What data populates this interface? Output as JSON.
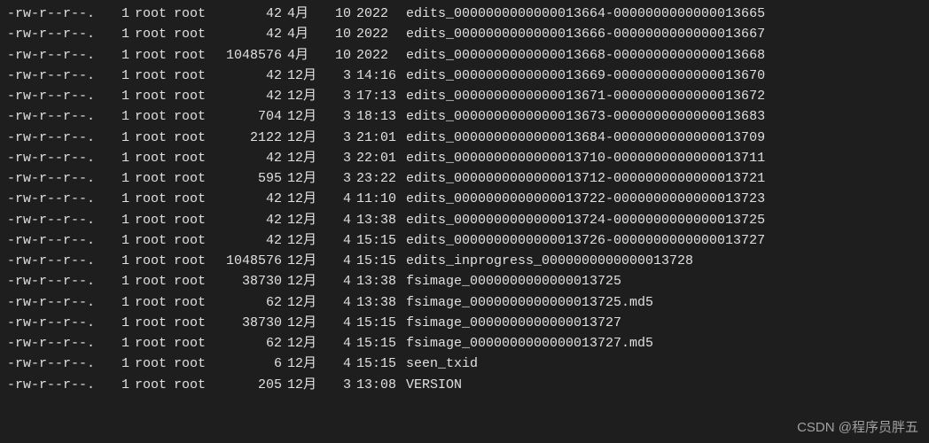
{
  "files": [
    {
      "perms": "-rw-r--r--.",
      "links": "1",
      "owner": "root",
      "group": "root",
      "size": "42",
      "month": "4月",
      "day": "10",
      "time": "2022",
      "name": "edits_0000000000000013664-0000000000000013665"
    },
    {
      "perms": "-rw-r--r--.",
      "links": "1",
      "owner": "root",
      "group": "root",
      "size": "42",
      "month": "4月",
      "day": "10",
      "time": "2022",
      "name": "edits_0000000000000013666-0000000000000013667"
    },
    {
      "perms": "-rw-r--r--.",
      "links": "1",
      "owner": "root",
      "group": "root",
      "size": "1048576",
      "month": "4月",
      "day": "10",
      "time": "2022",
      "name": "edits_0000000000000013668-0000000000000013668"
    },
    {
      "perms": "-rw-r--r--.",
      "links": "1",
      "owner": "root",
      "group": "root",
      "size": "42",
      "month": "12月",
      "day": "3",
      "time": "14:16",
      "name": "edits_0000000000000013669-0000000000000013670"
    },
    {
      "perms": "-rw-r--r--.",
      "links": "1",
      "owner": "root",
      "group": "root",
      "size": "42",
      "month": "12月",
      "day": "3",
      "time": "17:13",
      "name": "edits_0000000000000013671-0000000000000013672"
    },
    {
      "perms": "-rw-r--r--.",
      "links": "1",
      "owner": "root",
      "group": "root",
      "size": "704",
      "month": "12月",
      "day": "3",
      "time": "18:13",
      "name": "edits_0000000000000013673-0000000000000013683"
    },
    {
      "perms": "-rw-r--r--.",
      "links": "1",
      "owner": "root",
      "group": "root",
      "size": "2122",
      "month": "12月",
      "day": "3",
      "time": "21:01",
      "name": "edits_0000000000000013684-0000000000000013709"
    },
    {
      "perms": "-rw-r--r--.",
      "links": "1",
      "owner": "root",
      "group": "root",
      "size": "42",
      "month": "12月",
      "day": "3",
      "time": "22:01",
      "name": "edits_0000000000000013710-0000000000000013711"
    },
    {
      "perms": "-rw-r--r--.",
      "links": "1",
      "owner": "root",
      "group": "root",
      "size": "595",
      "month": "12月",
      "day": "3",
      "time": "23:22",
      "name": "edits_0000000000000013712-0000000000000013721"
    },
    {
      "perms": "-rw-r--r--.",
      "links": "1",
      "owner": "root",
      "group": "root",
      "size": "42",
      "month": "12月",
      "day": "4",
      "time": "11:10",
      "name": "edits_0000000000000013722-0000000000000013723"
    },
    {
      "perms": "-rw-r--r--.",
      "links": "1",
      "owner": "root",
      "group": "root",
      "size": "42",
      "month": "12月",
      "day": "4",
      "time": "13:38",
      "name": "edits_0000000000000013724-0000000000000013725"
    },
    {
      "perms": "-rw-r--r--.",
      "links": "1",
      "owner": "root",
      "group": "root",
      "size": "42",
      "month": "12月",
      "day": "4",
      "time": "15:15",
      "name": "edits_0000000000000013726-0000000000000013727"
    },
    {
      "perms": "-rw-r--r--.",
      "links": "1",
      "owner": "root",
      "group": "root",
      "size": "1048576",
      "month": "12月",
      "day": "4",
      "time": "15:15",
      "name": "edits_inprogress_0000000000000013728"
    },
    {
      "perms": "-rw-r--r--.",
      "links": "1",
      "owner": "root",
      "group": "root",
      "size": "38730",
      "month": "12月",
      "day": "4",
      "time": "13:38",
      "name": "fsimage_0000000000000013725"
    },
    {
      "perms": "-rw-r--r--.",
      "links": "1",
      "owner": "root",
      "group": "root",
      "size": "62",
      "month": "12月",
      "day": "4",
      "time": "13:38",
      "name": "fsimage_0000000000000013725.md5"
    },
    {
      "perms": "-rw-r--r--.",
      "links": "1",
      "owner": "root",
      "group": "root",
      "size": "38730",
      "month": "12月",
      "day": "4",
      "time": "15:15",
      "name": "fsimage_0000000000000013727"
    },
    {
      "perms": "-rw-r--r--.",
      "links": "1",
      "owner": "root",
      "group": "root",
      "size": "62",
      "month": "12月",
      "day": "4",
      "time": "15:15",
      "name": "fsimage_0000000000000013727.md5"
    },
    {
      "perms": "-rw-r--r--.",
      "links": "1",
      "owner": "root",
      "group": "root",
      "size": "6",
      "month": "12月",
      "day": "4",
      "time": "15:15",
      "name": "seen_txid"
    },
    {
      "perms": "-rw-r--r--.",
      "links": "1",
      "owner": "root",
      "group": "root",
      "size": "205",
      "month": "12月",
      "day": "3",
      "time": "13:08",
      "name": "VERSION"
    }
  ],
  "watermark": "CSDN @程序员胖五"
}
